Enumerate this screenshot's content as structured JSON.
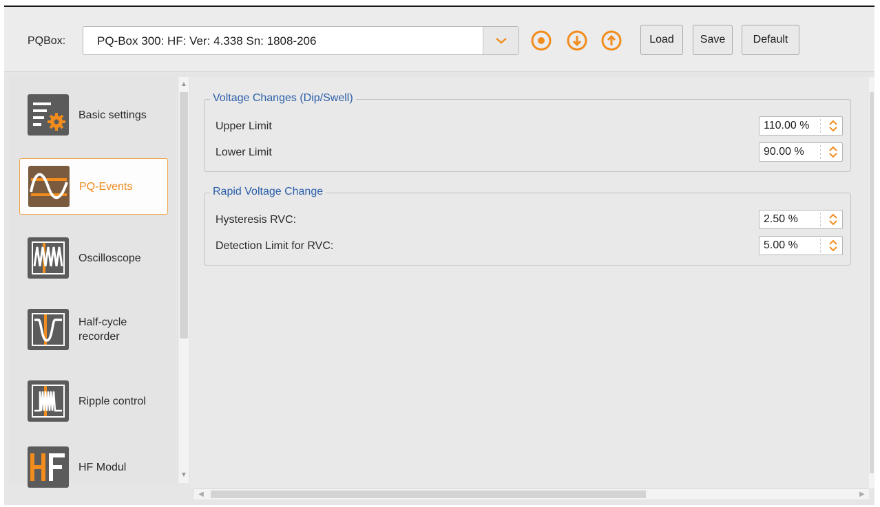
{
  "toolbar": {
    "device_label": "PQBox:",
    "device_value": "PQ-Box 300: HF: Ver: 4.338 Sn: 1808-206",
    "load_label": "Load",
    "save_label": "Save",
    "default_label": "Default",
    "accent_color": "#f28c1c"
  },
  "sidebar": {
    "items": [
      {
        "label": "Basic settings",
        "icon": "basic-settings-icon",
        "active": false
      },
      {
        "label": "PQ-Events",
        "icon": "pq-events-icon",
        "active": true
      },
      {
        "label": "Oscilloscope",
        "icon": "oscilloscope-icon",
        "active": false
      },
      {
        "label": "Half-cycle\nrecorder",
        "icon": "half-cycle-recorder-icon",
        "active": false
      },
      {
        "label": "Ripple control",
        "icon": "ripple-control-icon",
        "active": false
      },
      {
        "label": "HF Modul",
        "icon": "hf-modul-icon",
        "active": false
      }
    ]
  },
  "main": {
    "voltage_changes": {
      "title": "Voltage Changes (Dip/Swell)",
      "upper_limit_label": "Upper Limit",
      "upper_limit_value": "110.00 %",
      "lower_limit_label": "Lower Limit",
      "lower_limit_value": "90.00 %"
    },
    "rapid_voltage_change": {
      "title": "Rapid Voltage Change",
      "hysteresis_label": "Hysteresis RVC:",
      "hysteresis_value": "2.50 %",
      "detection_label": "Detection Limit for RVC:",
      "detection_value": "5.00 %"
    }
  }
}
